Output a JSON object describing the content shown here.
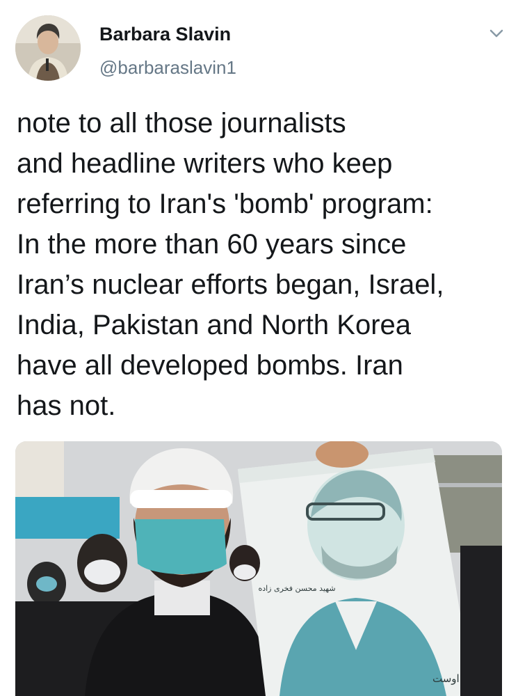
{
  "tweet": {
    "author": {
      "display_name": "Barbara Slavin",
      "handle": "@barbaraslavin1",
      "avatar_icon": "profile-photo"
    },
    "menu_icon": "chevron-down-icon",
    "text_lines": [
      "note to all those journalists",
      "and headline writers who keep",
      "referring to Iran's 'bomb' program:",
      "In the more than 60 years since",
      "Iran’s nuclear efforts began, Israel,",
      "India, Pakistan and North Korea",
      "have all developed bombs. Iran",
      "has not."
    ],
    "media": {
      "poster_caption": "مقام والای شهادت پاداش الهی تلاشهای عالم مجاهد اوست",
      "poster_signature": "شهید محسن فخری زاده"
    }
  },
  "colors": {
    "text": "#14171a",
    "secondary": "#657786",
    "background": "#ffffff",
    "mask": "#4fb3b8"
  }
}
